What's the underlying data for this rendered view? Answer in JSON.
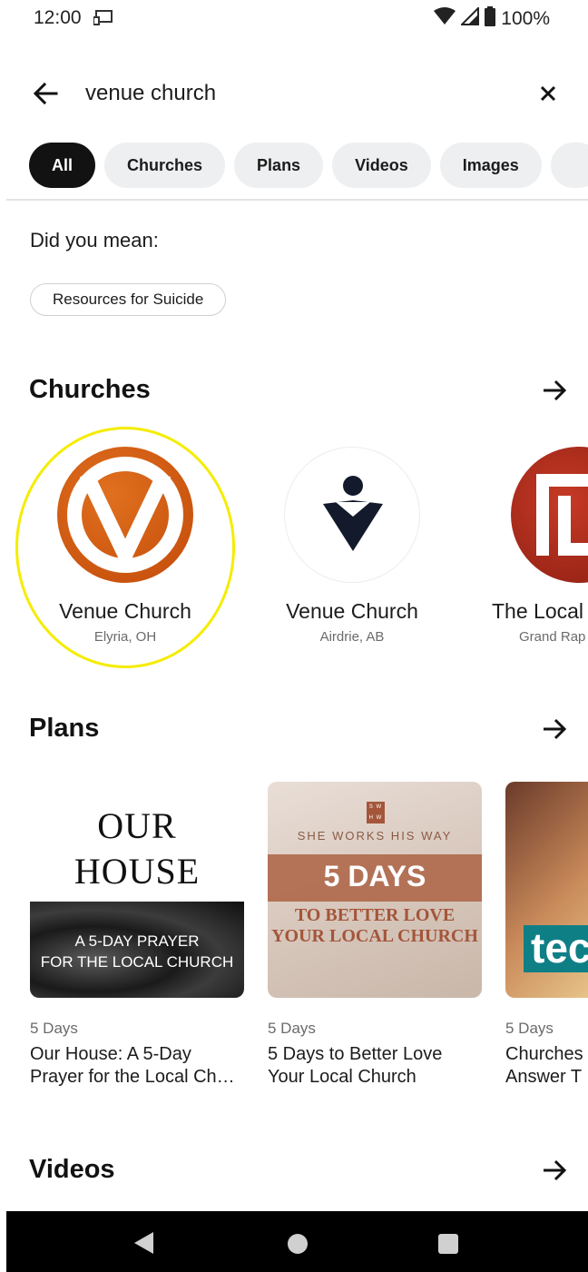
{
  "status_bar": {
    "time": "12:00",
    "battery": "100%",
    "icons": [
      "cast-icon",
      "wifi-icon",
      "signal-icon",
      "battery-icon"
    ]
  },
  "search": {
    "query": "venue church",
    "back_icon": "arrow-left-icon",
    "clear_icon": "close-icon"
  },
  "filters": [
    {
      "label": "All",
      "active": true
    },
    {
      "label": "Churches",
      "active": false
    },
    {
      "label": "Plans",
      "active": false
    },
    {
      "label": "Videos",
      "active": false
    },
    {
      "label": "Images",
      "active": false
    }
  ],
  "did_you_mean": {
    "label": "Did you mean:",
    "suggestion": "Resources for Suicide"
  },
  "sections": {
    "churches": "Churches",
    "plans": "Plans",
    "videos": "Videos"
  },
  "churches": [
    {
      "name": "Venue Church",
      "location": "Elyria, OH"
    },
    {
      "name": "Venue Church",
      "location": "Airdrie, AB"
    },
    {
      "name": "The Local",
      "location": "Grand Rap"
    }
  ],
  "plans": [
    {
      "days": "5 Days",
      "title": "Our House: A 5-Day Prayer for the Local Ch…",
      "cover": {
        "line1": "OUR",
        "line2": "HOUSE",
        "sub1": "A 5-DAY PRAYER",
        "sub2": "FOR THE LOCAL CHURCH"
      }
    },
    {
      "days": "5 Days",
      "title": "5 Days to Better Love Your Local Church",
      "cover": {
        "badge": "S W H W",
        "brand": "SHE WORKS HIS WAY",
        "headline": "5 DAYS",
        "sub1": "TO BETTER LOVE",
        "sub2": "YOUR LOCAL CHURCH"
      }
    },
    {
      "days": "5 Days",
      "title": "Churches Answer T",
      "cover": {
        "text": "tec"
      }
    }
  ],
  "colors": {
    "accent_orange": "#d4580f",
    "highlight": "#f5ec00",
    "chip_bg": "#edeff0",
    "chip_active_bg": "#121212"
  }
}
